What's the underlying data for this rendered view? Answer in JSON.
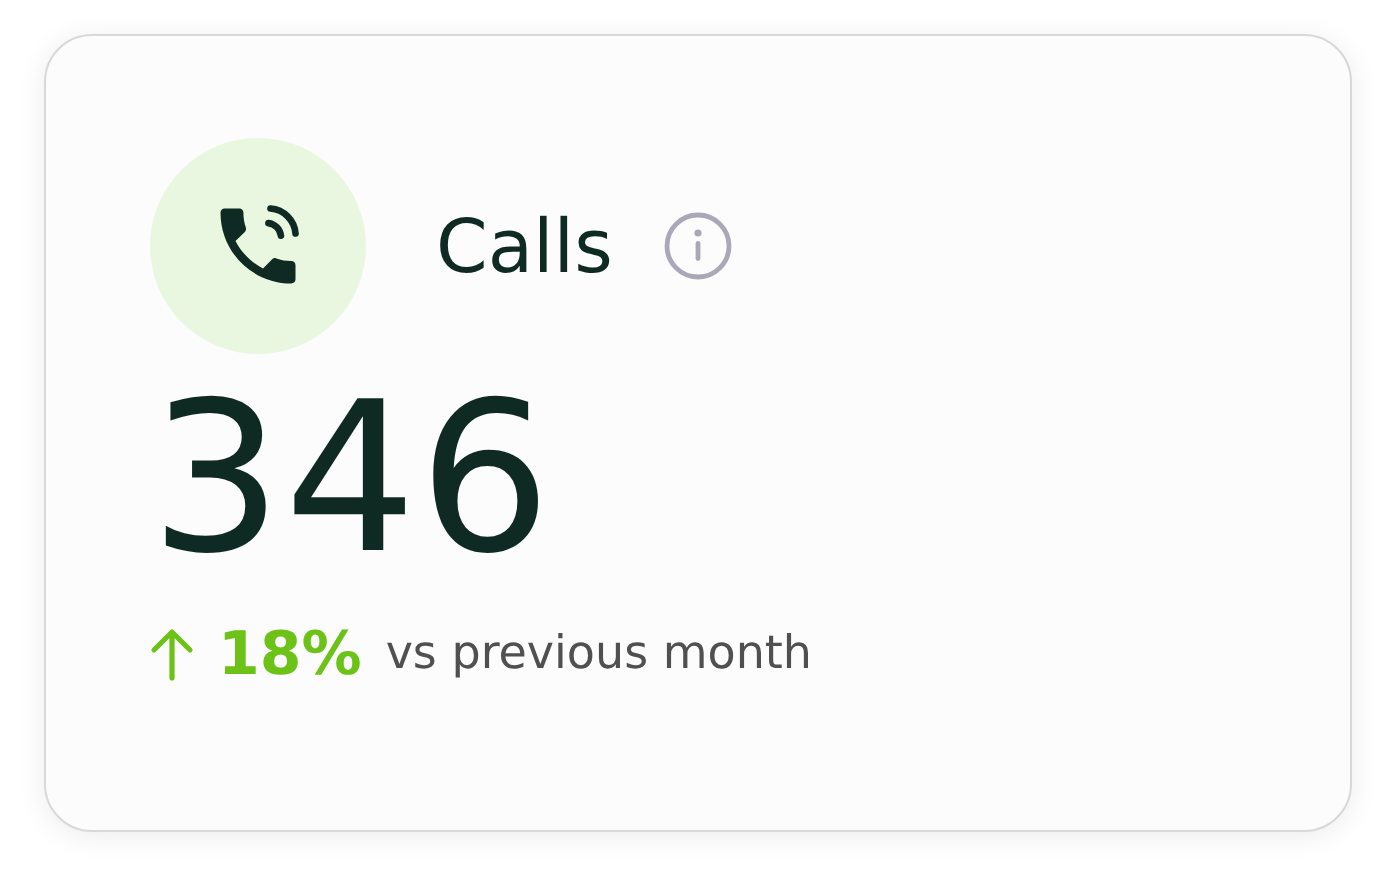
{
  "card": {
    "title": "Calls",
    "value": "346",
    "change": {
      "increase": true,
      "text": "18%"
    },
    "comparison": "vs previous month"
  }
}
